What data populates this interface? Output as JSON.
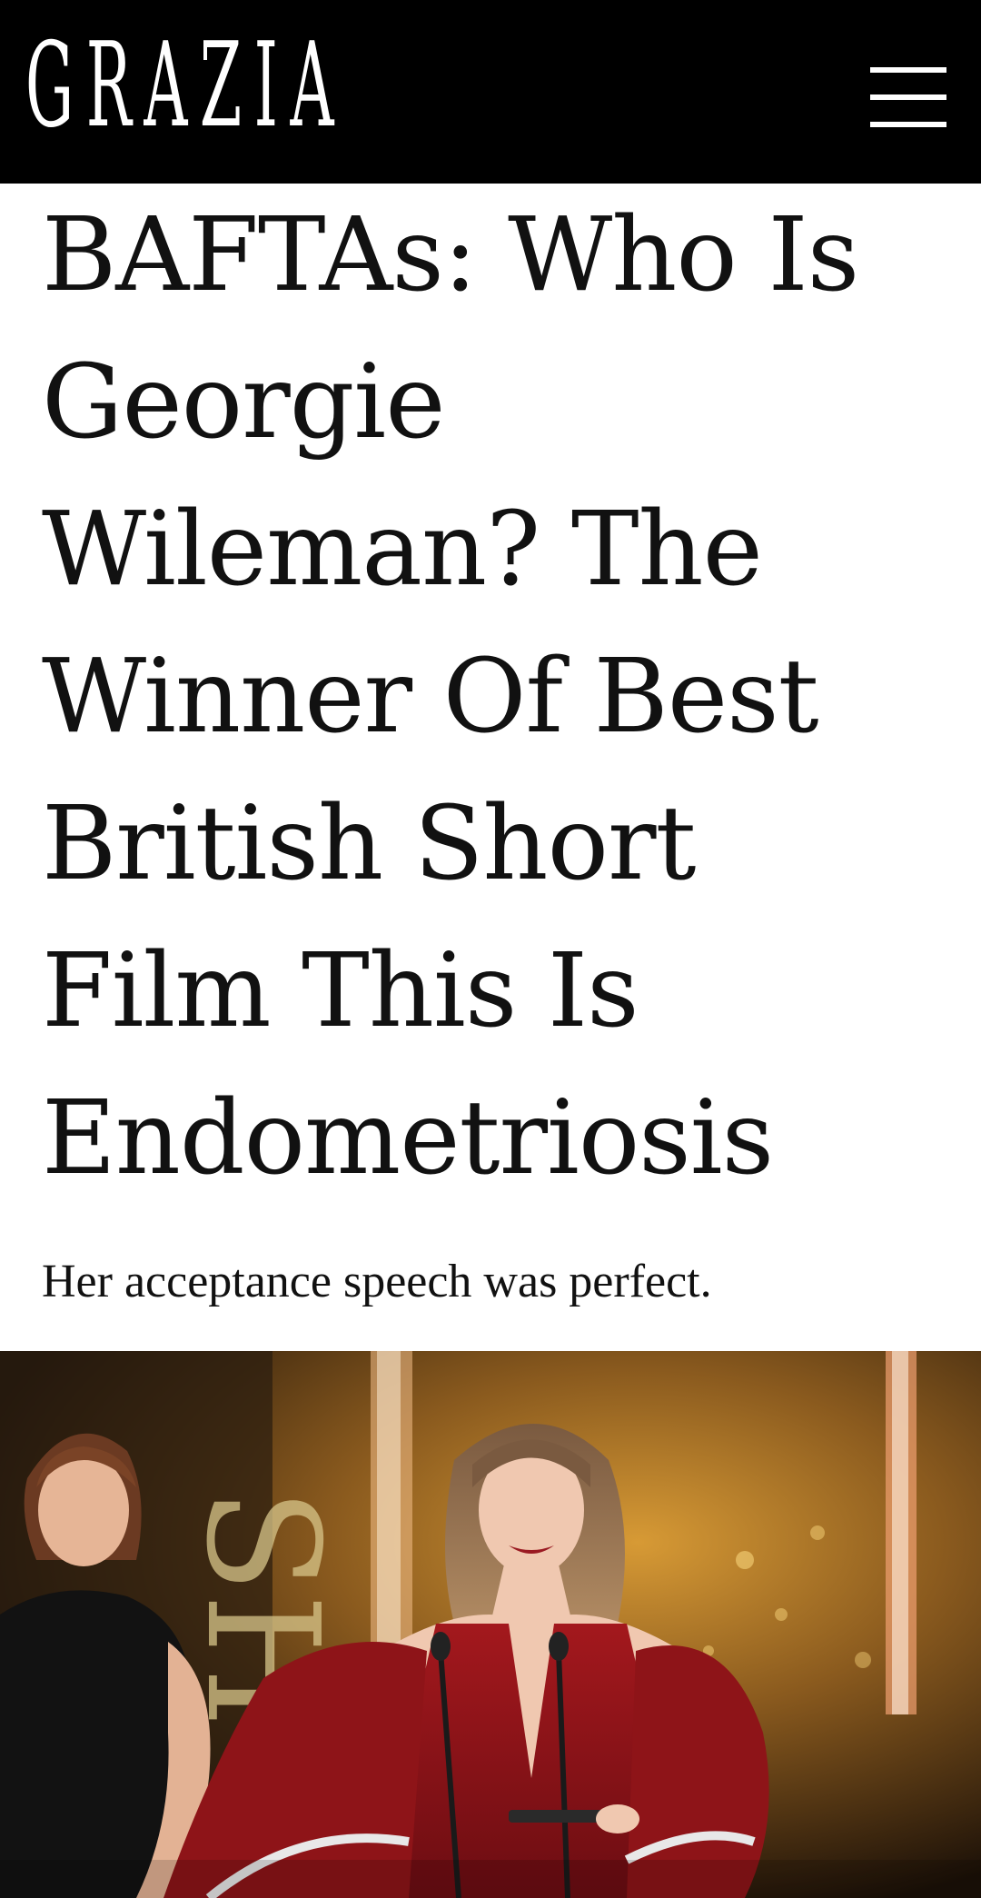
{
  "header": {
    "logo": "GRAZIA",
    "menu_icon": "hamburger-menu-icon",
    "background": "#000000"
  },
  "article": {
    "headline": "BAFTAs: Who Is Georgie Wileman? The Winner Of Best British Short Film This Is Endometriosis",
    "standfirst": "Her acceptance speech was perfect."
  },
  "hero_image": {
    "description_icon": "photo",
    "accent_red": "#8e1418",
    "stage_gold": "#c68a2a"
  }
}
